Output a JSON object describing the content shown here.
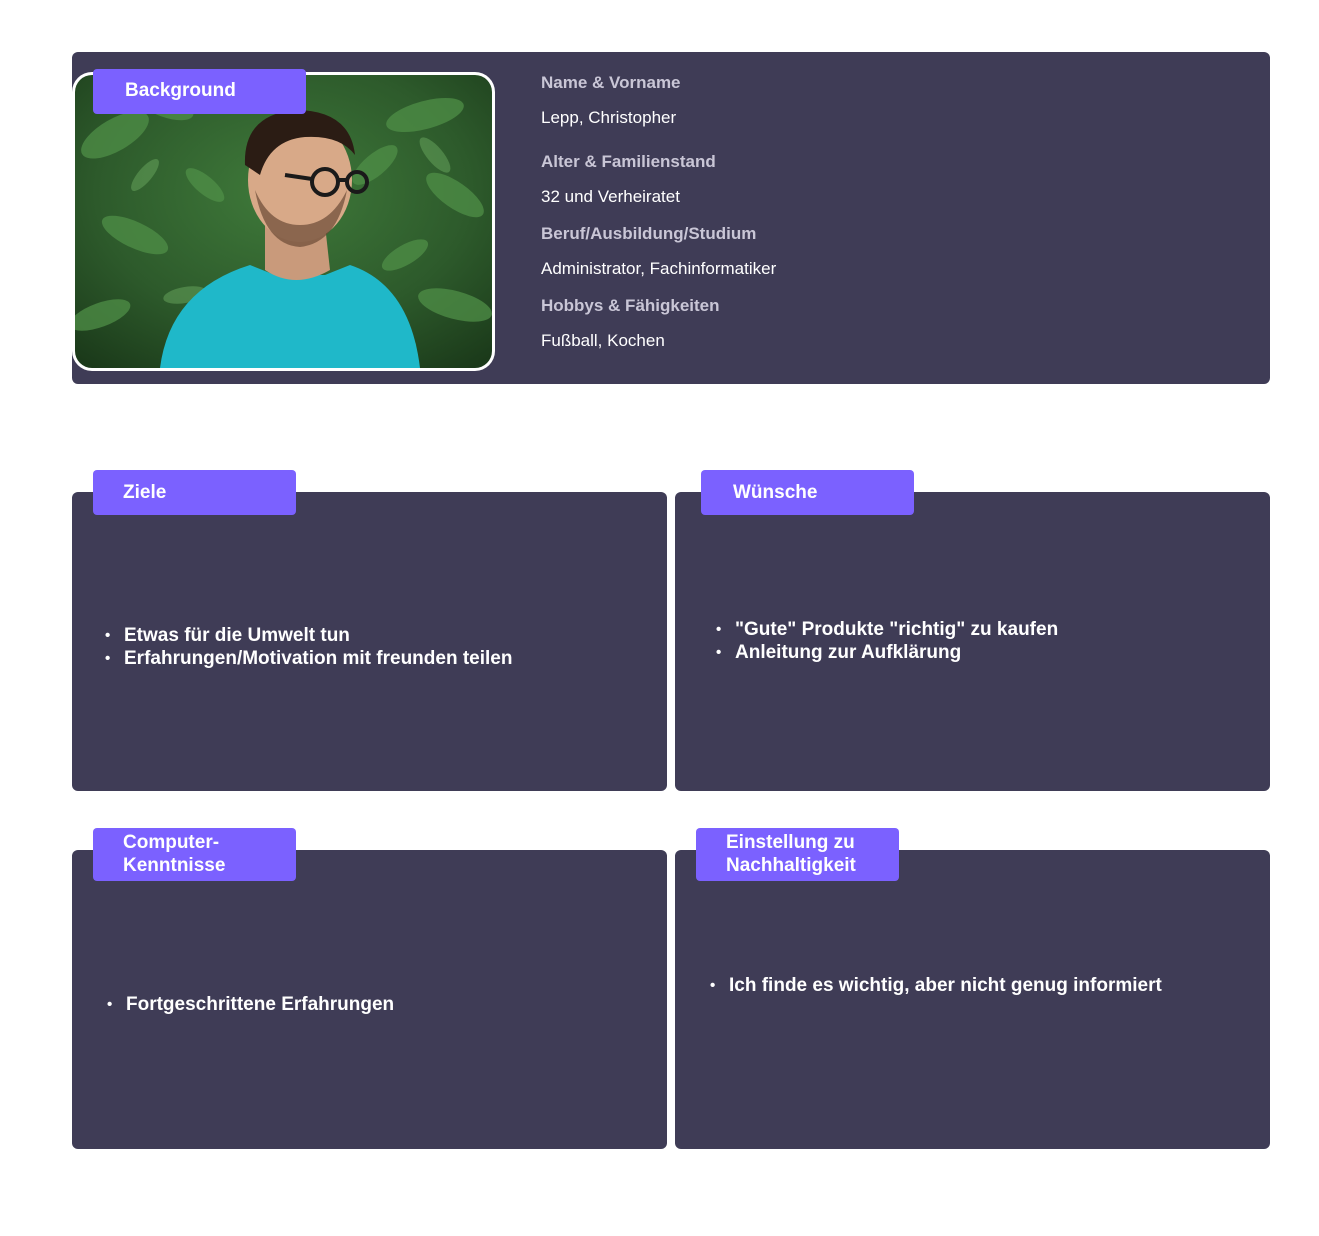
{
  "background": {
    "tab_label": "Background",
    "photo": {
      "description_icon": "portrait-photo",
      "colors": {
        "foliage": "#2d5a2b",
        "shirt": "#1fb8c9"
      }
    },
    "fields": [
      {
        "label": "Name & Vorname",
        "value": "Lepp, Christopher"
      },
      {
        "label": "Alter & Familienstand",
        "value": "32 und Verheiratet"
      },
      {
        "label": "Beruf/Ausbildung/Studium",
        "value": "Administrator, Fachinformatiker"
      },
      {
        "label": "Hobbys & Fähigkeiten",
        "value": "Fußball, Kochen"
      }
    ]
  },
  "ziele": {
    "tab_label": "Ziele",
    "items": [
      "Etwas für die Umwelt tun",
      "Erfahrungen/Motivation mit freunden teilen"
    ]
  },
  "wuensche": {
    "tab_label": "Wünsche",
    "items": [
      "\"Gute\" Produkte \"richtig\" zu kaufen",
      "Anleitung zur Aufklärung"
    ]
  },
  "computer": {
    "tab_label_line1": "Computer-",
    "tab_label_line2": "Kenntnisse",
    "items": [
      "Fortgeschrittene Erfahrungen"
    ]
  },
  "nachhaltigkeit": {
    "tab_label_line1": "Einstellung zu",
    "tab_label_line2": "Nachhaltigkeit",
    "items": [
      "Ich finde es wichtig, aber nicht genug informiert"
    ]
  },
  "colors": {
    "panel": "#3f3c56",
    "accent": "#7b61ff",
    "label": "#c9c6d6",
    "text": "#ffffff"
  }
}
